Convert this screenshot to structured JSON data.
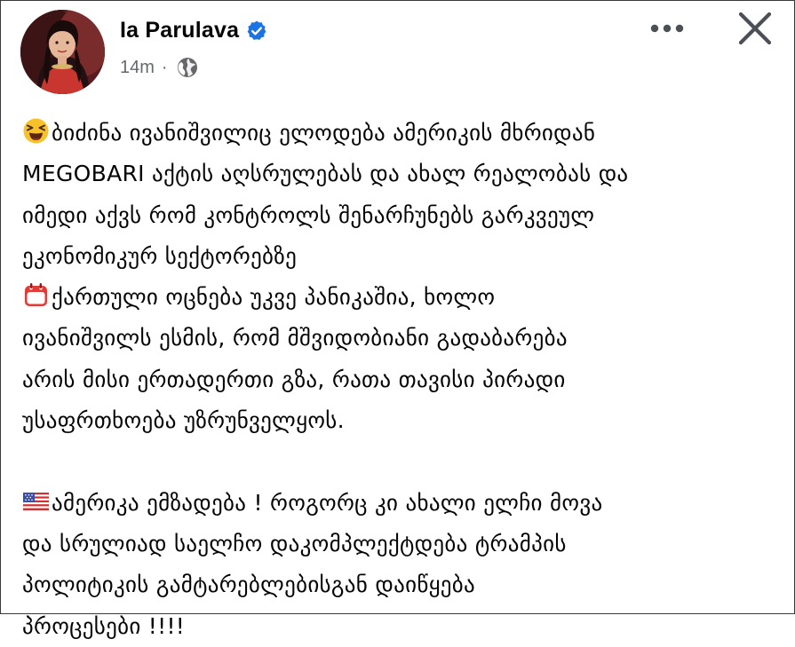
{
  "post": {
    "author_name": "Ia Parulava",
    "timestamp": "14m",
    "separator": "·",
    "audience_icon": "globe-icon",
    "verified_icon": "verified-badge-icon",
    "more_icon": "more-options-icon",
    "close_icon": "close-icon",
    "paragraphs": [
      {
        "emoji": "laughing-squinting-face-emoji",
        "lines": [
          "ბიძინა ივანიშვილიც ელოდება ამერიკის მხრიდან",
          "MEGOBARI აქტის აღსრულებას და ახალ რეალობას და",
          "იმედი აქვს რომ კონტროლს  შენარჩუნებს  გარკვეულ",
          "ეკონომიკურ სექტორებზე"
        ]
      },
      {
        "emoji": "calendar-emoji",
        "lines": [
          "ქართული ოცნება უკვე პანიკაშია, ხოლო",
          "ივანიშვილს ესმის, რომ მშვიდობიანი გადაბარება",
          "არის მისი ერთადერთი გზა, რათა თავისი პირადი",
          "უსაფრთხოება უზრუნველყოს."
        ]
      },
      {
        "emoji": "us-flag-emoji",
        "lines": [
          "ამერიკა ემზადება ! როგორც კი ახალი ელჩი მოვა",
          "და სრულიად საელჩო დაკომპლექტდება ტრამპის",
          "პოლიტიკის გამტარებლებისგან დაიწყება",
          "პროცესები !!!!"
        ]
      }
    ]
  },
  "colors": {
    "text": "#050505",
    "meta": "#65676b",
    "verified": "#1b74e4",
    "icon": "#4b4f56"
  }
}
